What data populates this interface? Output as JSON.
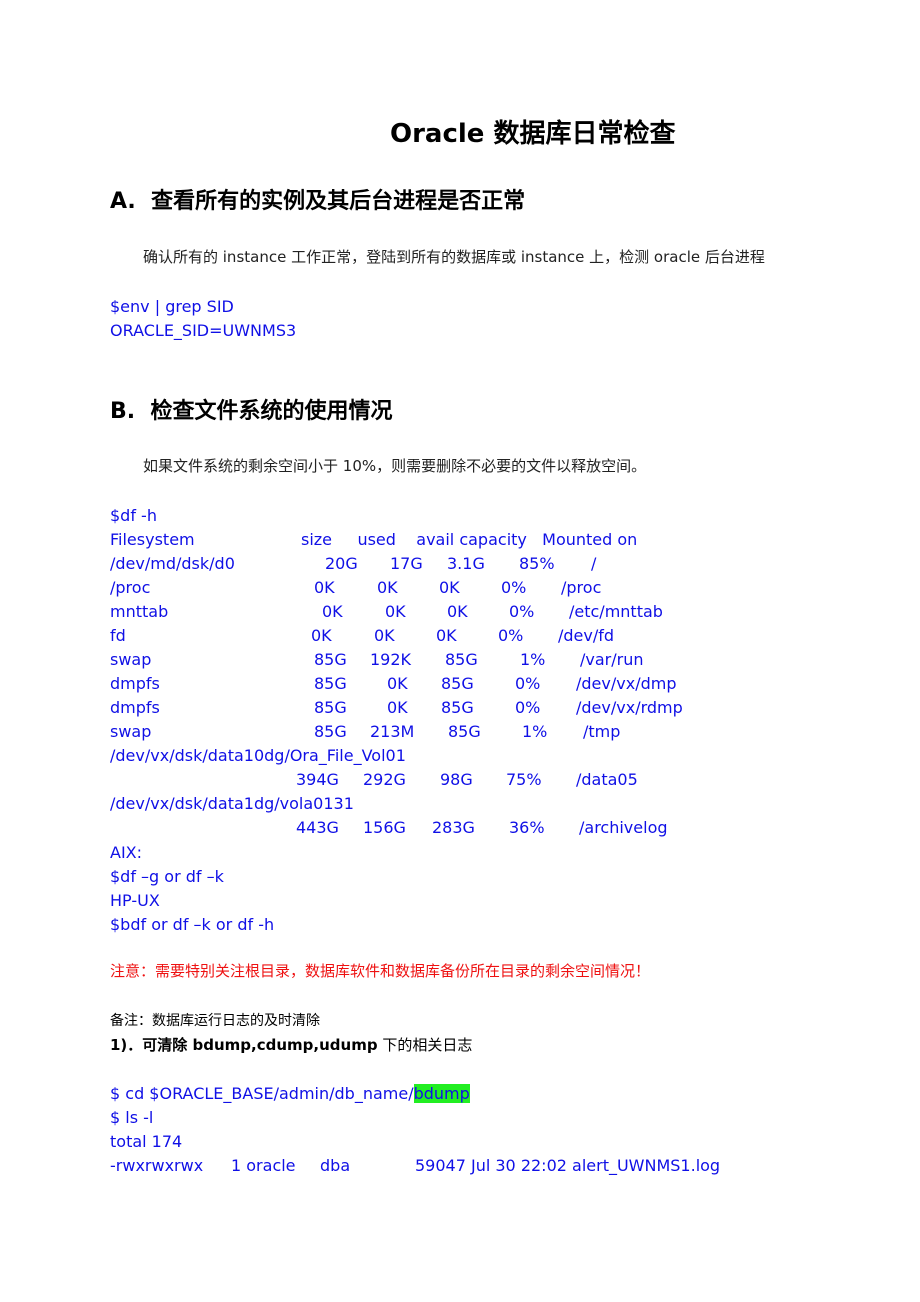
{
  "document": {
    "title": "Oracle 数据库日常检查",
    "sections": [
      {
        "heading": "A.  查看所有的实例及其后台进程是否正常",
        "paragraph": "确认所有的 instance 工作正常，登陆到所有的数据库或 instance 上，检测 oracle 后台进程",
        "code_lines": [
          "$env | grep SID",
          "ORACLE_SID=UWNMS3"
        ]
      },
      {
        "heading": "B.  检查文件系统的使用情况",
        "paragraph": "如果文件系统的剩余空间小于 10%，则需要删除不必要的文件以释放空间。",
        "command": "$df -h",
        "df_table": {
          "headers": [
            "Filesystem",
            "size",
            "used",
            "avail",
            "capacity",
            "Mounted on"
          ],
          "header_line": "size     used    avail capacity   Mounted on",
          "rows": [
            {
              "fs": "/dev/md/dsk/d0",
              "size": "20G",
              "used": "17G",
              "avail": "3.1G",
              "capacity": "85%",
              "mount": "/"
            },
            {
              "fs": "/proc",
              "size": "0K",
              "used": "0K",
              "avail": "0K",
              "capacity": "0%",
              "mount": "/proc"
            },
            {
              "fs": "mnttab",
              "size": "0K",
              "used": "0K",
              "avail": "0K",
              "capacity": "0%",
              "mount": "/etc/mnttab"
            },
            {
              "fs": "fd",
              "size": "0K",
              "used": "0K",
              "avail": "0K",
              "capacity": "0%",
              "mount": "/dev/fd"
            },
            {
              "fs": "swap",
              "size": "85G",
              "used": "192K",
              "avail": "85G",
              "capacity": "1%",
              "mount": "/var/run"
            },
            {
              "fs": "dmpfs",
              "size": "85G",
              "used": "0K",
              "avail": "85G",
              "capacity": "0%",
              "mount": "/dev/vx/dmp"
            },
            {
              "fs": "dmpfs",
              "size": "85G",
              "used": "0K",
              "avail": "85G",
              "capacity": "0%",
              "mount": "/dev/vx/rdmp"
            },
            {
              "fs": "swap",
              "size": "85G",
              "used": "213M",
              "avail": "85G",
              "capacity": "1%",
              "mount": "/tmp"
            },
            {
              "fs": "/dev/vx/dsk/data10dg/Ora_File_Vol01",
              "size": "394G",
              "used": "292G",
              "avail": "98G",
              "capacity": "75%",
              "mount": "/data05"
            },
            {
              "fs": "/dev/vx/dsk/data1dg/vola0131",
              "size": "443G",
              "used": "156G",
              "avail": "283G",
              "capacity": "36%",
              "mount": "/archivelog"
            }
          ]
        },
        "other_platforms": [
          "AIX:",
          "$df –g or df –k",
          "HP-UX",
          "$bdf or df –k or df -h"
        ],
        "warning": "注意：需要特别关注根目录，数据库软件和数据库备份所在目录的剩余空间情况！",
        "note_label": "备注：数据库运行日志的及时清除",
        "note_item": {
          "prefix": "1)．可清除 ",
          "bold_terms": "bdump,cdump,udump",
          "suffix": " 下的相关日志"
        },
        "log_commands": {
          "cd_prefix": "$ cd $ORACLE_BASE/admin/db_name/",
          "cd_highlight": "bdump",
          "ls": "$ ls -l",
          "total": "total 174",
          "listing": {
            "perms": "-rwxrwxrwx",
            "links_owner": "1 oracle",
            "group": "dba",
            "details": "59047 Jul 30 22:02 alert_UWNMS1.log"
          }
        }
      }
    ],
    "colors": {
      "code": "#1010e6",
      "warning": "#ee1111",
      "highlight": "#22ee22"
    }
  }
}
